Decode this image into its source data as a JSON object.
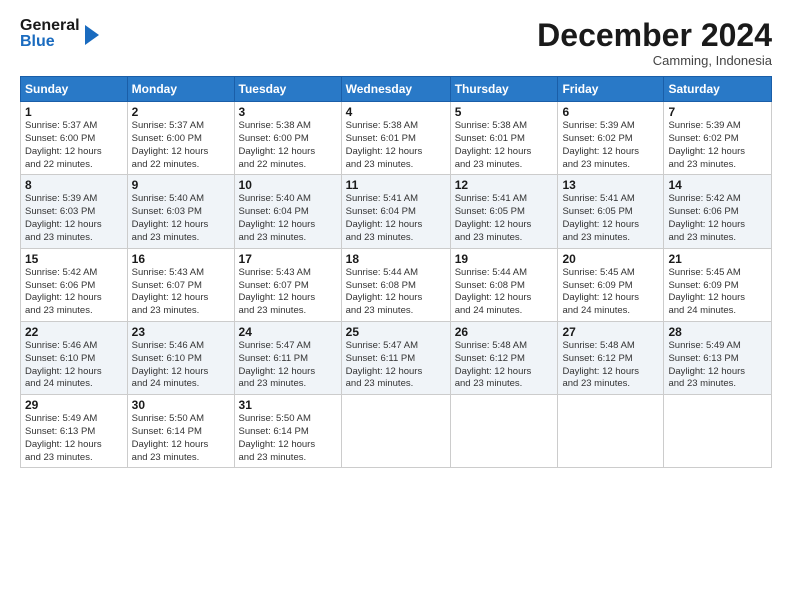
{
  "header": {
    "logo_general": "General",
    "logo_blue": "Blue",
    "month_title": "December 2024",
    "location": "Camming, Indonesia"
  },
  "weekdays": [
    "Sunday",
    "Monday",
    "Tuesday",
    "Wednesday",
    "Thursday",
    "Friday",
    "Saturday"
  ],
  "weeks": [
    [
      {
        "day": "1",
        "info": "Sunrise: 5:37 AM\nSunset: 6:00 PM\nDaylight: 12 hours\nand 22 minutes."
      },
      {
        "day": "2",
        "info": "Sunrise: 5:37 AM\nSunset: 6:00 PM\nDaylight: 12 hours\nand 22 minutes."
      },
      {
        "day": "3",
        "info": "Sunrise: 5:38 AM\nSunset: 6:00 PM\nDaylight: 12 hours\nand 22 minutes."
      },
      {
        "day": "4",
        "info": "Sunrise: 5:38 AM\nSunset: 6:01 PM\nDaylight: 12 hours\nand 23 minutes."
      },
      {
        "day": "5",
        "info": "Sunrise: 5:38 AM\nSunset: 6:01 PM\nDaylight: 12 hours\nand 23 minutes."
      },
      {
        "day": "6",
        "info": "Sunrise: 5:39 AM\nSunset: 6:02 PM\nDaylight: 12 hours\nand 23 minutes."
      },
      {
        "day": "7",
        "info": "Sunrise: 5:39 AM\nSunset: 6:02 PM\nDaylight: 12 hours\nand 23 minutes."
      }
    ],
    [
      {
        "day": "8",
        "info": "Sunrise: 5:39 AM\nSunset: 6:03 PM\nDaylight: 12 hours\nand 23 minutes."
      },
      {
        "day": "9",
        "info": "Sunrise: 5:40 AM\nSunset: 6:03 PM\nDaylight: 12 hours\nand 23 minutes."
      },
      {
        "day": "10",
        "info": "Sunrise: 5:40 AM\nSunset: 6:04 PM\nDaylight: 12 hours\nand 23 minutes."
      },
      {
        "day": "11",
        "info": "Sunrise: 5:41 AM\nSunset: 6:04 PM\nDaylight: 12 hours\nand 23 minutes."
      },
      {
        "day": "12",
        "info": "Sunrise: 5:41 AM\nSunset: 6:05 PM\nDaylight: 12 hours\nand 23 minutes."
      },
      {
        "day": "13",
        "info": "Sunrise: 5:41 AM\nSunset: 6:05 PM\nDaylight: 12 hours\nand 23 minutes."
      },
      {
        "day": "14",
        "info": "Sunrise: 5:42 AM\nSunset: 6:06 PM\nDaylight: 12 hours\nand 23 minutes."
      }
    ],
    [
      {
        "day": "15",
        "info": "Sunrise: 5:42 AM\nSunset: 6:06 PM\nDaylight: 12 hours\nand 23 minutes."
      },
      {
        "day": "16",
        "info": "Sunrise: 5:43 AM\nSunset: 6:07 PM\nDaylight: 12 hours\nand 23 minutes."
      },
      {
        "day": "17",
        "info": "Sunrise: 5:43 AM\nSunset: 6:07 PM\nDaylight: 12 hours\nand 23 minutes."
      },
      {
        "day": "18",
        "info": "Sunrise: 5:44 AM\nSunset: 6:08 PM\nDaylight: 12 hours\nand 23 minutes."
      },
      {
        "day": "19",
        "info": "Sunrise: 5:44 AM\nSunset: 6:08 PM\nDaylight: 12 hours\nand 24 minutes."
      },
      {
        "day": "20",
        "info": "Sunrise: 5:45 AM\nSunset: 6:09 PM\nDaylight: 12 hours\nand 24 minutes."
      },
      {
        "day": "21",
        "info": "Sunrise: 5:45 AM\nSunset: 6:09 PM\nDaylight: 12 hours\nand 24 minutes."
      }
    ],
    [
      {
        "day": "22",
        "info": "Sunrise: 5:46 AM\nSunset: 6:10 PM\nDaylight: 12 hours\nand 24 minutes."
      },
      {
        "day": "23",
        "info": "Sunrise: 5:46 AM\nSunset: 6:10 PM\nDaylight: 12 hours\nand 24 minutes."
      },
      {
        "day": "24",
        "info": "Sunrise: 5:47 AM\nSunset: 6:11 PM\nDaylight: 12 hours\nand 23 minutes."
      },
      {
        "day": "25",
        "info": "Sunrise: 5:47 AM\nSunset: 6:11 PM\nDaylight: 12 hours\nand 23 minutes."
      },
      {
        "day": "26",
        "info": "Sunrise: 5:48 AM\nSunset: 6:12 PM\nDaylight: 12 hours\nand 23 minutes."
      },
      {
        "day": "27",
        "info": "Sunrise: 5:48 AM\nSunset: 6:12 PM\nDaylight: 12 hours\nand 23 minutes."
      },
      {
        "day": "28",
        "info": "Sunrise: 5:49 AM\nSunset: 6:13 PM\nDaylight: 12 hours\nand 23 minutes."
      }
    ],
    [
      {
        "day": "29",
        "info": "Sunrise: 5:49 AM\nSunset: 6:13 PM\nDaylight: 12 hours\nand 23 minutes."
      },
      {
        "day": "30",
        "info": "Sunrise: 5:50 AM\nSunset: 6:14 PM\nDaylight: 12 hours\nand 23 minutes."
      },
      {
        "day": "31",
        "info": "Sunrise: 5:50 AM\nSunset: 6:14 PM\nDaylight: 12 hours\nand 23 minutes."
      },
      null,
      null,
      null,
      null
    ]
  ]
}
